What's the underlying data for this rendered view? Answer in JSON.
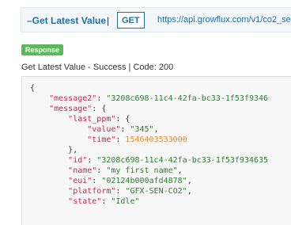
{
  "header": {
    "title": "–Get Latest Value",
    "separator": "|",
    "method": "GET",
    "url": "https://api.growflux.com/v1/co2_senso"
  },
  "response": {
    "badge": "Response",
    "status_text": "Get Latest Value - Success | Code: 200"
  },
  "code": {
    "open_brace": "{",
    "message2_key": "\"message2\"",
    "message2_value": "\"3208c698-11c4-42fa-bc33-1f53f9346",
    "message_key": "\"message\"",
    "message_open": ": {",
    "last_ppm_key": "\"last_ppm\"",
    "last_ppm_open": ": {",
    "value_key": "\"value\"",
    "value_value": "\"345\"",
    "time_key": "\"time\"",
    "time_value": "1546403533000",
    "close_inner": "},",
    "id_key": "\"id\"",
    "id_value": "\"3208c698-11c4-42fa-bc33-1f53f934635",
    "name_key": "\"name\"",
    "name_value": "\"my first name\"",
    "eui_key": "\"eui\"",
    "eui_value": "\"02124b000afd4878\"",
    "platform_key": "\"platform\"",
    "platform_value": "\"GFX-SEN-CO2\"",
    "state_key": "\"state\"",
    "state_value": "\"Idle\""
  },
  "colors": {
    "accent": "#1e6fa6",
    "badge": "#5cb85c",
    "json_key": "#c7254e",
    "json_string": "#2e7d32",
    "json_number": "#e5892e"
  }
}
